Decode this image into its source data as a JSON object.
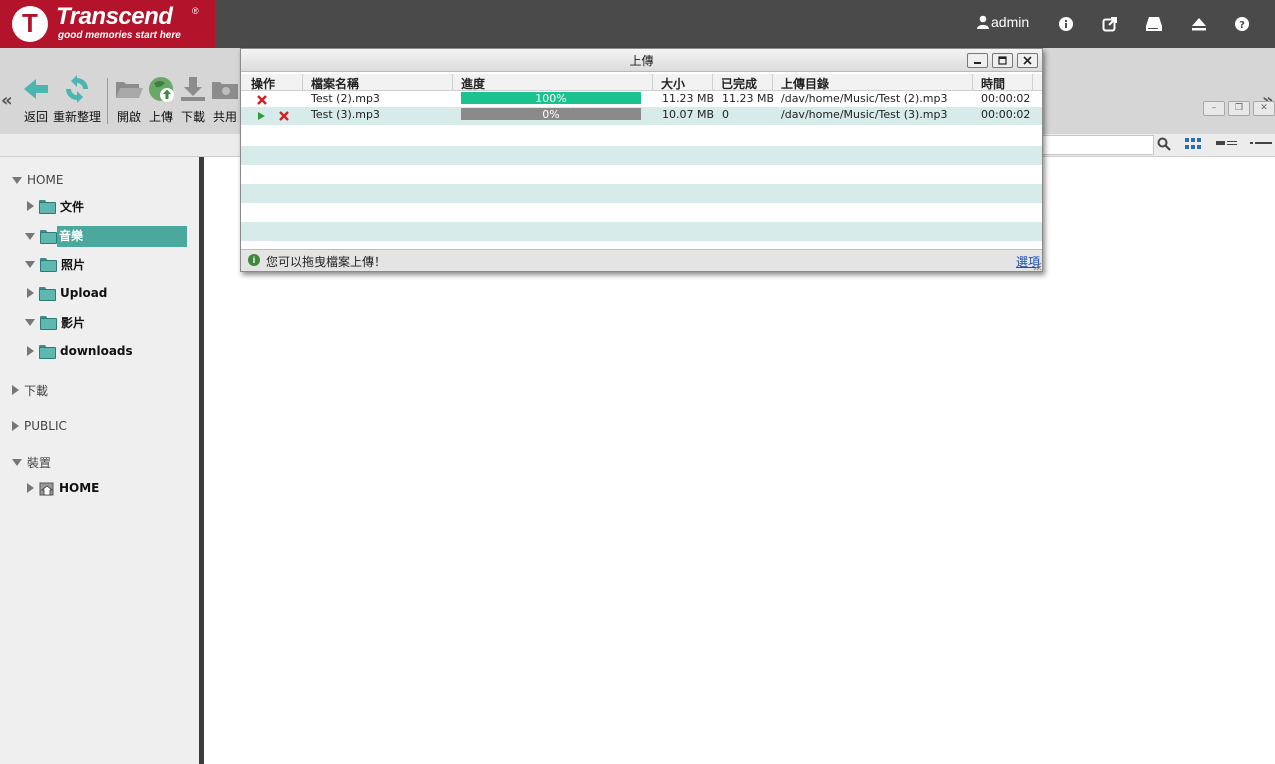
{
  "header": {
    "brand": "Transcend",
    "brand_mark": "®",
    "tagline": "good memories start here",
    "user": "admin",
    "icons": [
      "user-icon",
      "info-icon",
      "external-link-icon",
      "drive-icon",
      "eject-icon",
      "help-icon"
    ]
  },
  "toolbar": {
    "prev": "«",
    "next": "»",
    "buttons": [
      {
        "label": "返回",
        "icon": "back-arrow-icon"
      },
      {
        "label": "重新整理",
        "icon": "refresh-icon"
      },
      {
        "label": "開啟",
        "icon": "open-folder-icon"
      },
      {
        "label": "上傳",
        "icon": "upload-globe-icon"
      },
      {
        "label": "下載",
        "icon": "download-icon"
      },
      {
        "label": "共用",
        "icon": "share-folder-icon"
      }
    ]
  },
  "sidebar": {
    "home_label": "HOME",
    "home_children": [
      "文件",
      "音樂",
      "照片",
      "Upload",
      "影片",
      "downloads"
    ],
    "selected": "音樂",
    "downloads_label": "下載",
    "public_label": "PUBLIC",
    "devices_label": "裝置",
    "device_children": [
      "HOME"
    ]
  },
  "dialog": {
    "title": "上傳",
    "columns": [
      "操作",
      "檔案名稱",
      "進度",
      "大小",
      "已完成",
      "上傳目錄",
      "時間"
    ],
    "rows": [
      {
        "name": "Test (2).mp3",
        "progress": "100%",
        "progress_value": 1.0,
        "size": "11.23 MB",
        "done": "11.23 MB",
        "dir": "/dav/home/Music/Test (2).mp3",
        "time": "00:00:02"
      },
      {
        "name": "Test (3).mp3",
        "progress": "0%",
        "progress_value": 0.0,
        "size": "10.07 MB",
        "done": "0",
        "dir": "/dav/home/Music/Test (3).mp3",
        "time": "00:00:02"
      }
    ],
    "footer_msg": "您可以拖曳檔案上傳！",
    "footer_link": "選項"
  },
  "colors": {
    "brand_red": "#b3132b",
    "header_gray": "#4a4a4a",
    "selection_teal": "#4aa89c",
    "progress_done": "#19c28f",
    "progress_idle": "#8a8a8a",
    "row_alt": "#d6ebea"
  }
}
